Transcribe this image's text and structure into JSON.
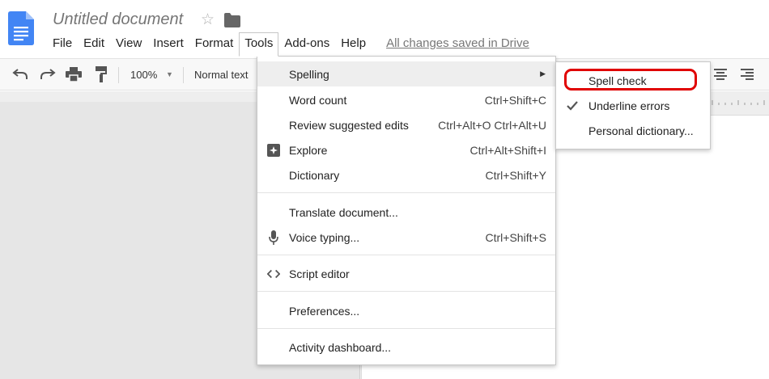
{
  "header": {
    "doc_title": "Untitled document",
    "menu": [
      "File",
      "Edit",
      "View",
      "Insert",
      "Format",
      "Tools",
      "Add-ons",
      "Help"
    ],
    "save_status": "All changes saved in Drive"
  },
  "toolbar": {
    "zoom": "100%",
    "paragraph_style": "Normal text"
  },
  "tools_menu": {
    "items": [
      {
        "label": "Spelling",
        "shortcut": "",
        "submenu": true
      },
      {
        "label": "Word count",
        "shortcut": "Ctrl+Shift+C"
      },
      {
        "label": "Review suggested edits",
        "shortcut": "Ctrl+Alt+O Ctrl+Alt+U"
      },
      {
        "label": "Explore",
        "shortcut": "Ctrl+Alt+Shift+I"
      },
      {
        "label": "Dictionary",
        "shortcut": "Ctrl+Shift+Y"
      },
      {
        "label": "Translate document...",
        "shortcut": ""
      },
      {
        "label": "Voice typing...",
        "shortcut": "Ctrl+Shift+S"
      },
      {
        "label": "Script editor",
        "shortcut": ""
      },
      {
        "label": "Preferences...",
        "shortcut": ""
      },
      {
        "label": "Activity dashboard...",
        "shortcut": ""
      }
    ]
  },
  "spelling_submenu": {
    "items": [
      {
        "label": "Spell check",
        "checked": false
      },
      {
        "label": "Underline errors",
        "checked": true
      },
      {
        "label": "Personal dictionary...",
        "checked": false
      }
    ]
  },
  "colors": {
    "doc_blue": "#4285f4",
    "highlight_red": "#e00000",
    "menu_hover": "#eeeeee"
  },
  "icons": [
    "docs-logo-icon",
    "star-icon",
    "folder-icon",
    "undo-icon",
    "redo-icon",
    "print-icon",
    "paint-format-icon",
    "explore-icon",
    "microphone-icon",
    "code-icon",
    "checkmark-icon",
    "align-center-icon",
    "align-right-icon"
  ]
}
